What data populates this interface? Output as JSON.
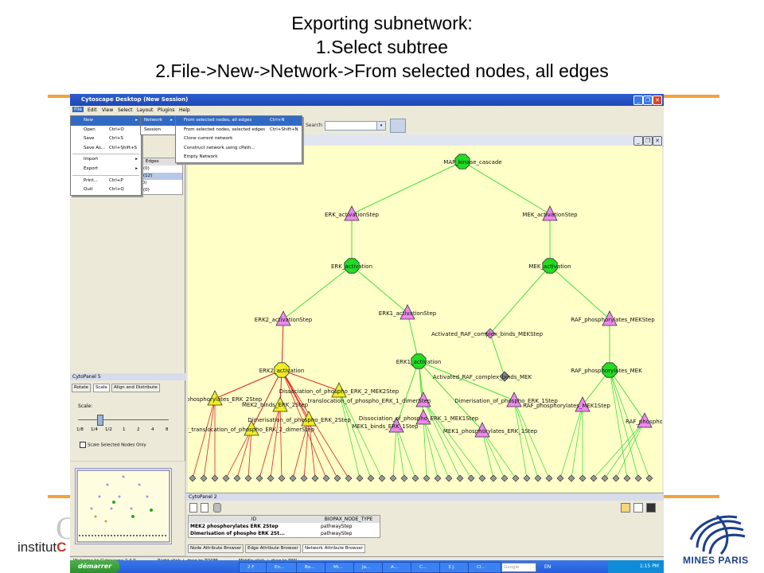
{
  "slide": {
    "title_lines": [
      "Exporting subnetwork:",
      "1.Select subtree",
      "2.File->New->Network->From selected nodes, all edges"
    ],
    "accent_color": "#f2a33a",
    "logo_left": {
      "institut": "institut",
      "letter": "C"
    },
    "logo_right": {
      "text": "MINES PARIS"
    }
  },
  "window": {
    "title": "Cytoscape Desktop (New Session)",
    "controls": [
      "_",
      "❐",
      "✕"
    ]
  },
  "menubar": [
    "File",
    "Edit",
    "View",
    "Select",
    "Layout",
    "Plugins",
    "Help"
  ],
  "toolbar": {
    "search_label": "Search:",
    "search_value": ""
  },
  "file_menu": [
    {
      "label": "New",
      "shortcut": "",
      "arrow": "▸",
      "active": true
    },
    {
      "label": "Open",
      "shortcut": "Ctrl+O"
    },
    {
      "label": "Save",
      "shortcut": "Ctrl+S"
    },
    {
      "label": "Save As...",
      "shortcut": "Ctrl+Shift+S"
    },
    {
      "label": "Import",
      "shortcut": "",
      "arrow": "▸"
    },
    {
      "label": "Export",
      "shortcut": "",
      "arrow": "▸"
    },
    {
      "label": "Print...",
      "shortcut": "Ctrl+P"
    },
    {
      "label": "Quit",
      "shortcut": "Ctrl+Q"
    }
  ],
  "new_submenu": [
    {
      "label": "Network",
      "arrow": "▸",
      "active": true
    },
    {
      "label": "Session"
    }
  ],
  "network_submenu": [
    {
      "label": "From selected nodes, all edges",
      "shortcut": "Ctrl+N",
      "active": true
    },
    {
      "label": "From selected nodes, selected edges",
      "shortcut": "Ctrl+Shift+N"
    },
    {
      "label": "Clone current network",
      "shortcut": ""
    },
    {
      "label": "Construct network using cPath...",
      "shortcut": ""
    },
    {
      "label": "Empty Network",
      "shortcut": ""
    }
  ],
  "network_table": {
    "header": [
      "s",
      "Edges"
    ],
    "rows": [
      "45(0)",
      "41(12)",
      "0(0)",
      "35(0)"
    ]
  },
  "cytopanel5": {
    "title": "CytoPanel 5",
    "tabs": [
      "Rotate",
      "Scale",
      "Align and Distribute"
    ],
    "scale_label": "Scale:",
    "ticks": [
      "1/8",
      "1/4",
      "1/2",
      "1",
      "2",
      "4",
      "8"
    ],
    "checkbox_label": "Scale Selected Nodes Only"
  },
  "network": {
    "nodes": [
      {
        "name": "MAP_kinase_cascade",
        "shape": "octagon",
        "color": "#22dd22"
      },
      {
        "name": "ERK_activationStep",
        "shape": "triangle",
        "color": "#ee88ee"
      },
      {
        "name": "MEK_activationStep",
        "shape": "triangle",
        "color": "#ee88ee"
      },
      {
        "name": "ERK_activation",
        "shape": "octagon",
        "color": "#22dd22"
      },
      {
        "name": "MEK_activation",
        "shape": "octagon",
        "color": "#22dd22"
      },
      {
        "name": "ERK2_activationStep",
        "shape": "triangle",
        "color": "#ee88ee"
      },
      {
        "name": "ERK1_activationStep",
        "shape": "triangle",
        "color": "#ee88ee"
      },
      {
        "name": "Activated_RAF_complex_binds_MEKStep",
        "shape": "diamond",
        "color": "#ee88ee"
      },
      {
        "name": "RAF_phosphorylates_MEKStep",
        "shape": "triangle",
        "color": "#ee88ee"
      },
      {
        "name": "ERK2_activation",
        "shape": "octagon",
        "color": "#eeee22"
      },
      {
        "name": "ERK1_activation",
        "shape": "octagon",
        "color": "#22dd22"
      },
      {
        "name": "Activated_RAF_complex_binds_MEK",
        "shape": "diamond",
        "color": "#888888"
      },
      {
        "name": "RAF_phosphorylates_MEK",
        "shape": "octagon",
        "color": "#22dd22"
      },
      {
        "name": "phosphorylates_ERK_2Step",
        "shape": "triangle",
        "color": "#eeee22"
      },
      {
        "name": "Dissociation_of_phospho_ERK_2_MEK2Step",
        "shape": "triangle",
        "color": "#eeee22"
      },
      {
        "name": "MEK2_binds_ERK_2Step",
        "shape": "triangle",
        "color": "#eeee22"
      },
      {
        "name": "translocation_of_phospho_ERK_1_dimerStep",
        "shape": "triangle",
        "color": "#ee88ee"
      },
      {
        "name": "Dimerisation_of_phospho_ERK_1Step",
        "shape": "triangle",
        "color": "#ee88ee"
      },
      {
        "name": "RAF_phosphorylates_MEK1Step",
        "shape": "triangle",
        "color": "#ee88ee"
      },
      {
        "name": "Dissociation_of_phospho_ERK_1_MEK1Step",
        "shape": "triangle",
        "color": "#ee88ee"
      },
      {
        "name": "Dimerisation_of_phospho_ERK_2Step",
        "shape": "triangle",
        "color": "#eeee22"
      },
      {
        "name": "MEK1_binds_ERK_1Step",
        "shape": "triangle",
        "color": "#ee88ee"
      },
      {
        "name": "MEK1_phosphorylates_ERK_1Step",
        "shape": "triangle",
        "color": "#ee88ee"
      },
      {
        "name": "r_translocation_of_phospho_ERK_2_dimerStep",
        "shape": "triangle",
        "color": "#eeee22"
      },
      {
        "name": "RAF_phospho",
        "shape": "triangle",
        "color": "#ee88ee"
      }
    ]
  },
  "cytopanel2": {
    "title": "CytoPanel 2",
    "columns": [
      "ID",
      "BIOPAX_NODE_TYPE"
    ],
    "rows": [
      {
        "id": "MEK2 phosphorylates ERK 2Step",
        "type": "pathwayStep"
      },
      {
        "id": "Dimerisation of phospho ERK 2St...",
        "type": "pathwayStep"
      }
    ],
    "tabs": [
      "Node Attribute Browser",
      "Edge Attribute Browser",
      "Network Attribute Browser"
    ]
  },
  "statusbar": {
    "welcome": "Welcome to Cytoscape 2.4.0",
    "hint1": "Right-click + drag to ZOOM",
    "hint2": "Middle-click + drag to PAN"
  },
  "taskbar": {
    "start": "démarrer",
    "items": [
      "2 F",
      "En...",
      "Bo...",
      "Mi...",
      "Ja...",
      "A...",
      "C...",
      "3 J.",
      "Cl..."
    ],
    "search_value": "Google",
    "lang": "EN",
    "clock": "1:15 PM"
  }
}
